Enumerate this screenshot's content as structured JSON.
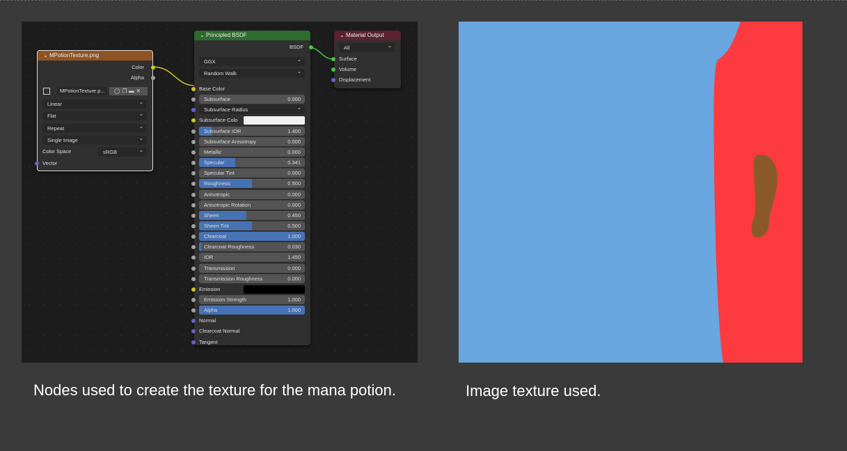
{
  "texture_node": {
    "title": "MPotionTexture.png",
    "outputs": [
      "Color",
      "Alpha"
    ],
    "image_name": "MPotionTexture.p...",
    "interpolation": "Linear",
    "projection": "Flat",
    "extension": "Repeat",
    "source": "Single Image",
    "color_space_label": "Color Space",
    "color_space": "sRGB",
    "input": "Vector",
    "header_color": "#8f5425"
  },
  "bsdf_node": {
    "title": "Principled BSDF",
    "output": "BSDF",
    "distribution": "GGX",
    "subsurface_method": "Random Walk",
    "header_color": "#2e6b2e",
    "rows": [
      {
        "t": "socket",
        "label": "Base Color",
        "sock": "#c7c729"
      },
      {
        "t": "slider",
        "label": "Subsurface",
        "value": "0.000",
        "fill": 0,
        "sock": "#a1a1a1"
      },
      {
        "t": "dropdown",
        "label": "Subsurface Radius",
        "sock": "#6363c7"
      },
      {
        "t": "color",
        "label": "Subsurface Colo",
        "color": "#f0f0f0",
        "sock": "#c7c729"
      },
      {
        "t": "slider",
        "label": "Subsurface IOR",
        "value": "1.400",
        "fill": 0.12,
        "sock": "#a1a1a1"
      },
      {
        "t": "slider",
        "label": "Subsurface Anisotropy",
        "value": "0.000",
        "fill": 0,
        "sock": "#a1a1a1"
      },
      {
        "t": "slider",
        "label": "Metallic",
        "value": "0.000",
        "fill": 0,
        "sock": "#a1a1a1"
      },
      {
        "t": "slider",
        "label": "Specular",
        "value": "0.341",
        "fill": 0.341,
        "sock": "#a1a1a1"
      },
      {
        "t": "slider",
        "label": "Specular Tint",
        "value": "0.000",
        "fill": 0,
        "sock": "#a1a1a1"
      },
      {
        "t": "slider",
        "label": "Roughness",
        "value": "0.500",
        "fill": 0.5,
        "sock": "#a1a1a1"
      },
      {
        "t": "slider",
        "label": "Anisotropic",
        "value": "0.000",
        "fill": 0,
        "sock": "#a1a1a1"
      },
      {
        "t": "slider",
        "label": "Anisotropic Rotation",
        "value": "0.000",
        "fill": 0,
        "sock": "#a1a1a1"
      },
      {
        "t": "slider",
        "label": "Sheen",
        "value": "0.450",
        "fill": 0.45,
        "sock": "#a1a1a1"
      },
      {
        "t": "slider",
        "label": "Sheen Tint",
        "value": "0.500",
        "fill": 0.5,
        "sock": "#a1a1a1"
      },
      {
        "t": "slider",
        "label": "Clearcoat",
        "value": "1.000",
        "fill": 1,
        "sock": "#a1a1a1"
      },
      {
        "t": "slider",
        "label": "Clearcoat Roughness",
        "value": "0.030",
        "fill": 0.02,
        "sock": "#a1a1a1"
      },
      {
        "t": "slider",
        "label": "IOR",
        "value": "1.450",
        "fill": 0,
        "sock": "#a1a1a1"
      },
      {
        "t": "slider",
        "label": "Transmission",
        "value": "0.000",
        "fill": 0,
        "sock": "#a1a1a1"
      },
      {
        "t": "slider",
        "label": "Transmission Roughness",
        "value": "0.000",
        "fill": 0,
        "sock": "#a1a1a1"
      },
      {
        "t": "color",
        "label": "Emission",
        "color": "#000000",
        "sock": "#c7c729"
      },
      {
        "t": "slider",
        "label": "Emission Strength",
        "value": "1.000",
        "fill": 0,
        "sock": "#a1a1a1"
      },
      {
        "t": "slider",
        "label": "Alpha",
        "value": "1.000",
        "fill": 1,
        "sock": "#a1a1a1"
      },
      {
        "t": "socket",
        "label": "Normal",
        "sock": "#6363c7"
      },
      {
        "t": "socket",
        "label": "Clearcoat Normal",
        "sock": "#6363c7"
      },
      {
        "t": "socket",
        "label": "Tangent",
        "sock": "#6363c7"
      }
    ]
  },
  "output_node": {
    "title": "Material Output",
    "target": "All",
    "inputs": [
      "Surface",
      "Volume",
      "Displacement"
    ],
    "header_color": "#5a2232"
  },
  "captions": {
    "left": "Nodes used to create the texture for the mana potion.",
    "right": "Image texture used."
  },
  "texture_colors": {
    "blue": "#6aa6df",
    "red": "#fd3a3f",
    "brown": "#8b5a2b"
  }
}
